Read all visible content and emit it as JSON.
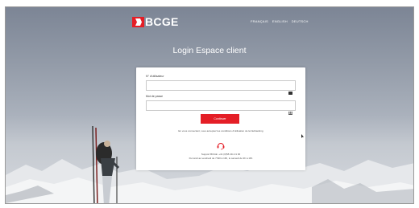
{
  "header": {
    "logo_text": "BCGE",
    "languages": [
      "FRANÇAIS",
      "ENGLISH",
      "DEUTSCH"
    ]
  },
  "page": {
    "title": "Login Espace client"
  },
  "login_form": {
    "username_label": "N° d'utilisateur",
    "username_value": "",
    "password_label": "Mot de passe",
    "password_value": "",
    "submit_label": "Continuer",
    "consent_text": "En vous connectant, vous acceptez les conditions d'utilisation de la Netbanking"
  },
  "support": {
    "icon": "headset-icon",
    "line1": "Support BCGE: +41 (0)58 211 21 00",
    "line2": "Du lundi au vendredi de 7h30 à 19h, le samedi de 9h à 16h"
  },
  "colors": {
    "accent": "#e41e26",
    "logo_mark": "#e41e26"
  }
}
